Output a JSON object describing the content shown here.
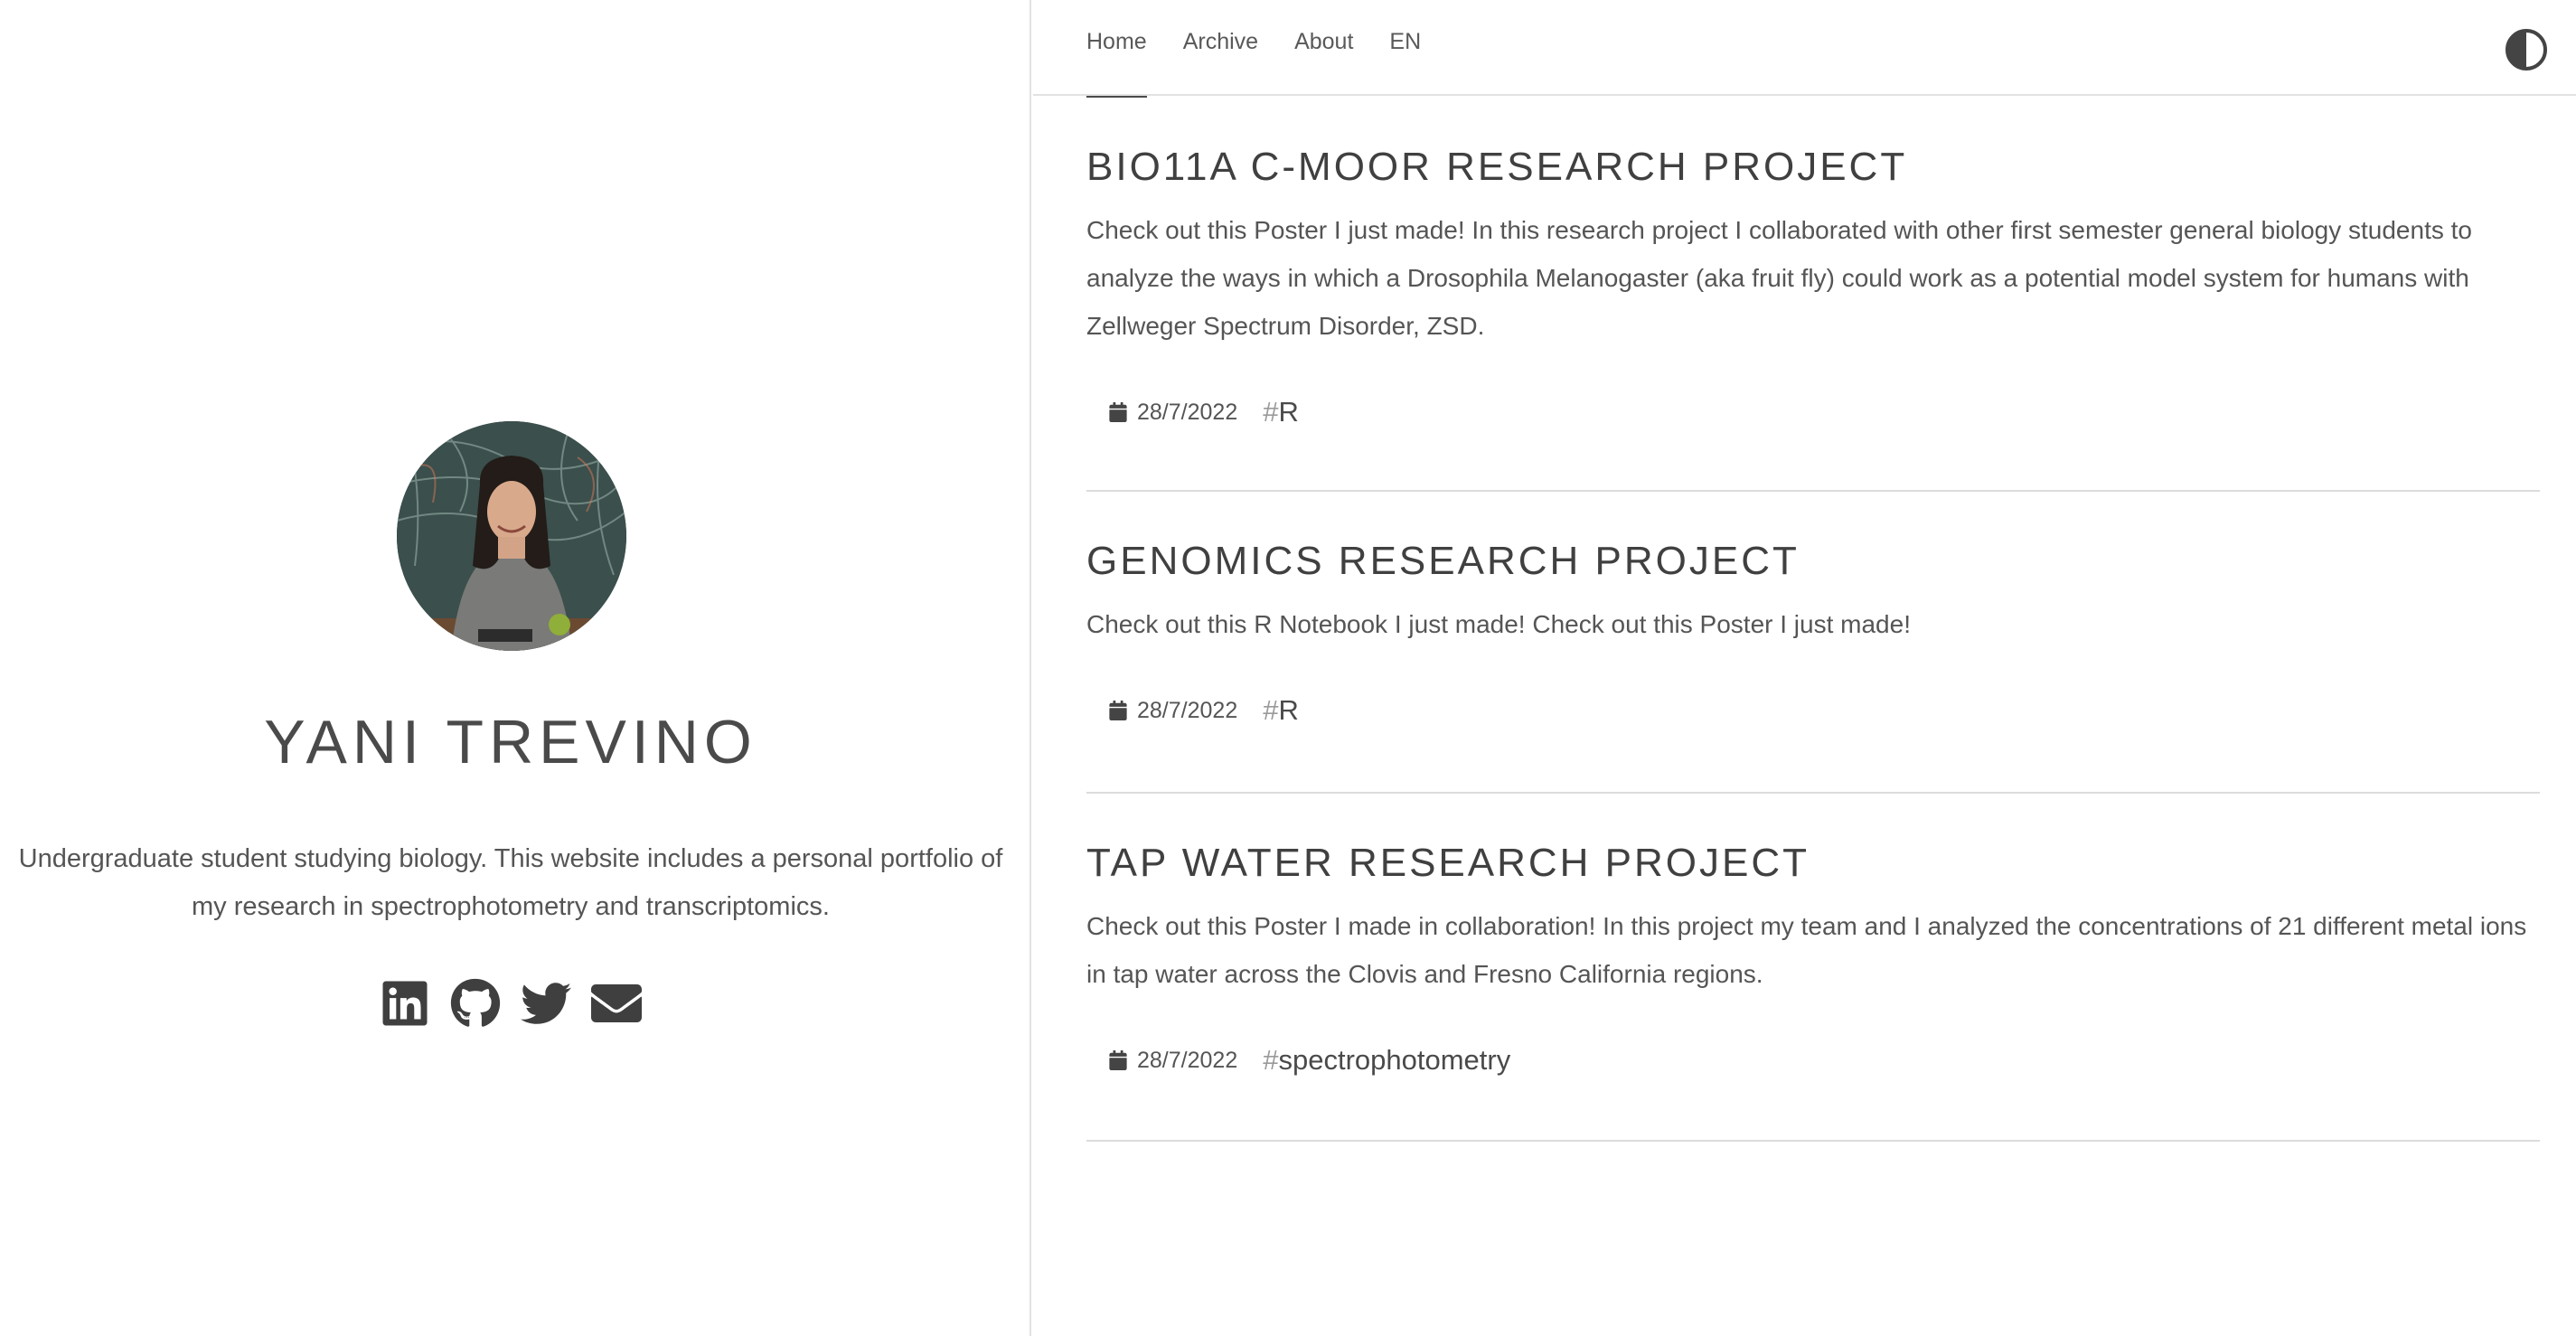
{
  "profile": {
    "name": "YANI TREVINO",
    "bio": "Undergraduate student studying biology. This website includes a personal portfolio of my research in spectrophotometry and transcriptomics.",
    "social": [
      {
        "icon": "linkedin-icon"
      },
      {
        "icon": "github-icon"
      },
      {
        "icon": "twitter-icon"
      },
      {
        "icon": "email-icon"
      }
    ]
  },
  "nav": {
    "items": [
      {
        "label": "Home",
        "active": true
      },
      {
        "label": "Archive",
        "active": false
      },
      {
        "label": "About",
        "active": false
      },
      {
        "label": "EN",
        "active": false
      }
    ],
    "theme_toggle_icon": "contrast-icon"
  },
  "posts": [
    {
      "title": "BIO11A C-MOOR RESEARCH PROJECT",
      "summary": "Check out this Poster I just made! In this research project I collaborated with other first semester general biology students to analyze the ways in which a Drosophila Melanogaster (aka fruit fly) could work as a potential model system for humans with Zellweger Spectrum Disorder, ZSD.",
      "date": "28/7/2022",
      "tag_hash": "#",
      "tag": "R"
    },
    {
      "title": "GENOMICS RESEARCH PROJECT",
      "summary": "Check out this R Notebook I just made! Check out this Poster I just made!",
      "date": "28/7/2022",
      "tag_hash": "#",
      "tag": "R"
    },
    {
      "title": "TAP WATER RESEARCH PROJECT",
      "summary": "Check out this Poster I made in collaboration! In this project my team and I analyzed the concentrations of 21 different metal ions in tap water across the Clovis and Fresno California regions.",
      "date": "28/7/2022",
      "tag_hash": "#",
      "tag": "spectrophotometry"
    }
  ],
  "colors": {
    "text": "#4a4a4a",
    "divider": "#dcdcdc",
    "background": "#ffffff"
  }
}
